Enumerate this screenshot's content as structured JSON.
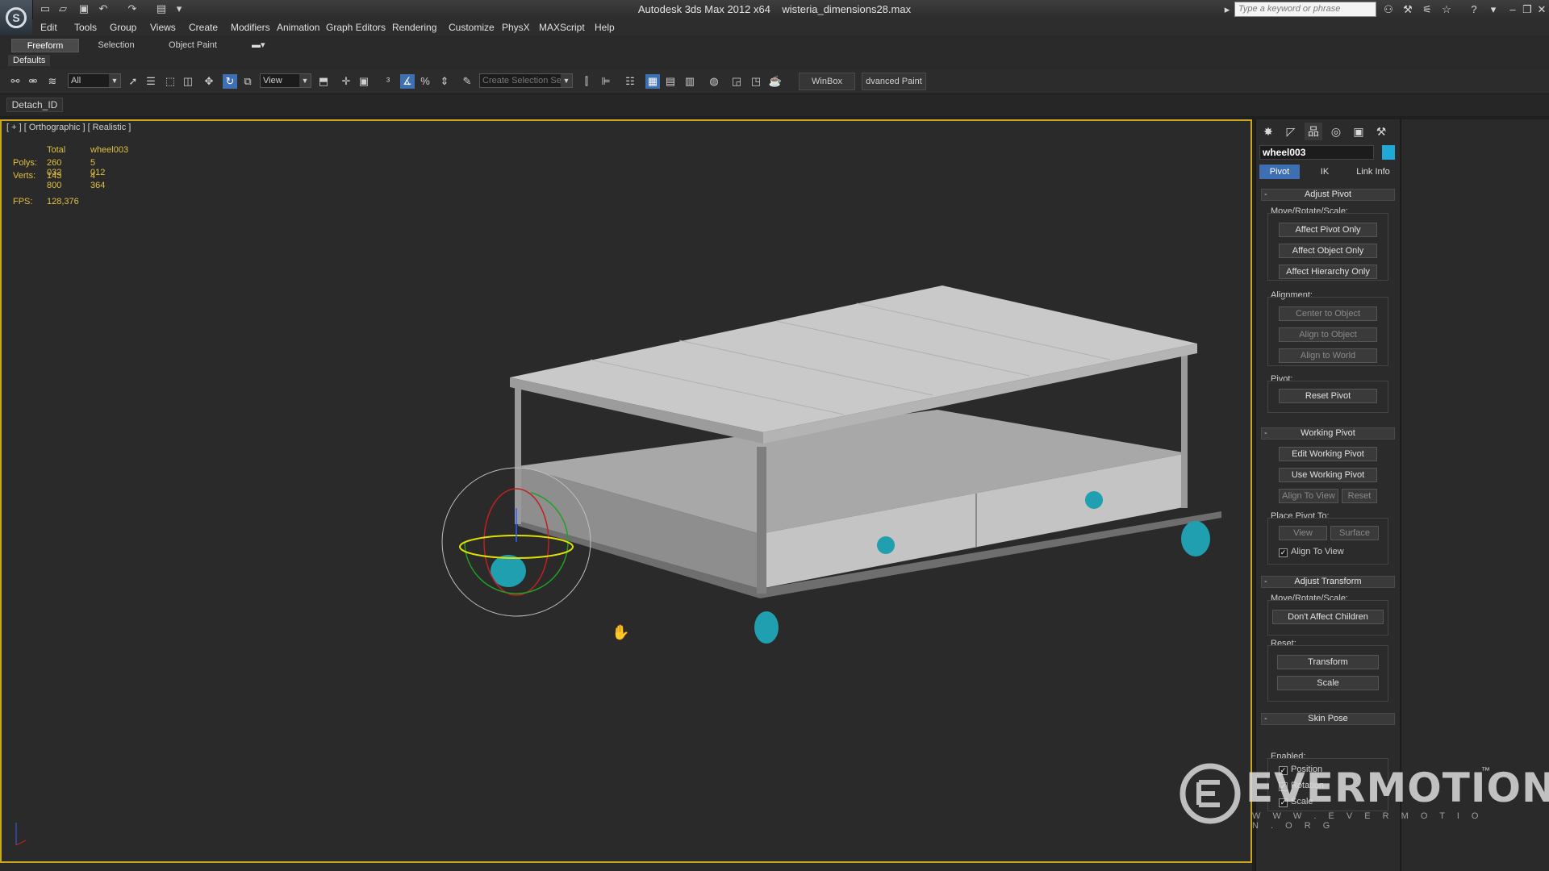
{
  "titlebar": {
    "app_name": "Autodesk 3ds Max  2012 x64",
    "file_name": "wisteria_dimensions28.max",
    "search_placeholder": "Type a keyword or phrase",
    "logo_glyph": "S"
  },
  "menubar": {
    "items": [
      "Edit",
      "Tools",
      "Group",
      "Views",
      "Create",
      "Modifiers",
      "Animation",
      "Graph Editors",
      "Rendering",
      "Customize",
      "PhysX",
      "MAXScript",
      "Help"
    ]
  },
  "ribbon": {
    "tabs": [
      "Freeform",
      "Selection",
      "Object Paint"
    ],
    "active_tab": "Freeform",
    "defaults_label": "Defaults"
  },
  "toolbar": {
    "filter_value": "All",
    "refcoord_value": "View",
    "selection_set_placeholder": "Create Selection Se",
    "winbox_label": "WinBox",
    "advanced_paint_label": "dvanced Paint"
  },
  "subbar": {
    "detach_label": "Detach_ID"
  },
  "viewport": {
    "label": "[ + ] [ Orthographic ] [ Realistic ]",
    "stats": {
      "header_total": "Total",
      "header_object": "wheel003",
      "polys_label": "Polys:",
      "polys_total": "260 032",
      "polys_object": "5 012",
      "verts_label": "Verts:",
      "verts_total": "143 800",
      "verts_object": "4 364",
      "fps_label": "FPS:",
      "fps_value": "128,376"
    },
    "table_colors": {
      "top": "#b8b8b8",
      "side": "#8c8c8c",
      "frame": "#9a9a9a",
      "wheel": "#1f9fb0"
    }
  },
  "command_panel": {
    "object_name": "wheel003",
    "object_color": "#20a8d8",
    "sub_tabs": [
      "Pivot",
      "IK",
      "Link Info"
    ],
    "active_sub_tab": "Pivot",
    "adjust_pivot": {
      "title": "Adjust Pivot",
      "move_label": "Move/Rotate/Scale:",
      "buttons": [
        "Affect Pivot Only",
        "Affect Object Only",
        "Affect Hierarchy Only"
      ],
      "alignment_label": "Alignment:",
      "alignment_buttons": [
        "Center to Object",
        "Align to Object",
        "Align to World"
      ],
      "pivot_label": "Pivot:",
      "reset_pivot": "Reset Pivot"
    },
    "working_pivot": {
      "title": "Working Pivot",
      "edit": "Edit Working Pivot",
      "use": "Use Working Pivot",
      "align_to_view": "Align To View",
      "reset": "Reset",
      "place_label": "Place Pivot To:",
      "view": "View",
      "surface": "Surface",
      "align_chk": "Align To View"
    },
    "adjust_transform": {
      "title": "Adjust Transform",
      "move_label": "Move/Rotate/Scale:",
      "dont_affect": "Don't Affect Children",
      "reset_label": "Reset:",
      "transform": "Transform",
      "scale": "Scale"
    },
    "skin_pose": {
      "title": "Skin Pose",
      "enabled_label": "Enabled:",
      "position": "Position",
      "rotation": "Rotation",
      "scale": "Scale"
    }
  },
  "watermark": {
    "brand": "EVERMOTION",
    "url": "W W W . E V E R M O T I O N . O R G",
    "tm": "™"
  }
}
